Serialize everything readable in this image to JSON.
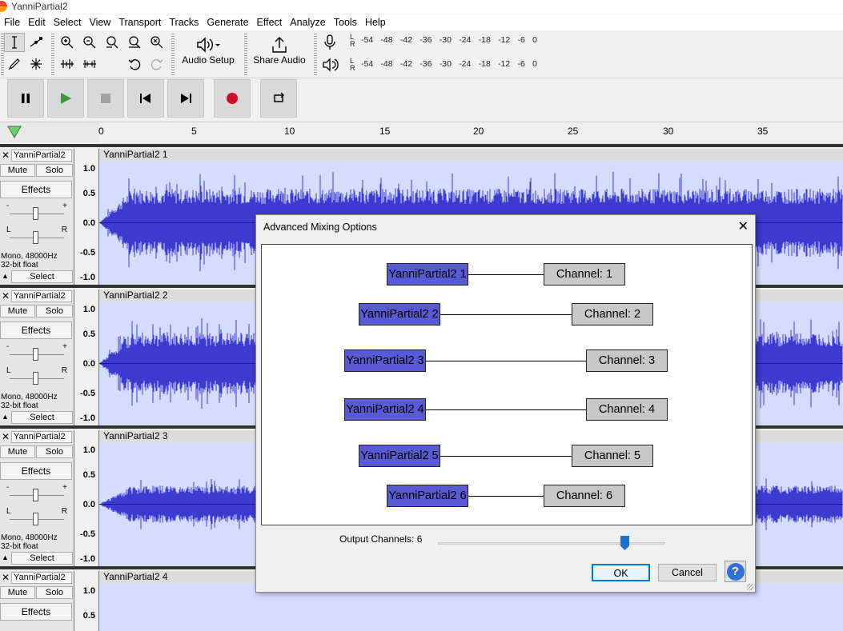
{
  "window": {
    "title": "YanniPartial2"
  },
  "menu": [
    "File",
    "Edit",
    "Select",
    "View",
    "Transport",
    "Tracks",
    "Generate",
    "Effect",
    "Analyze",
    "Tools",
    "Help"
  ],
  "toolbar": {
    "audio_setup": "Audio Setup",
    "share_audio": "Share Audio"
  },
  "meters": {
    "lr_top": "L",
    "lr_bottom": "R",
    "scale": [
      "-54",
      "-48",
      "-42",
      "-36",
      "-30",
      "-24",
      "-18",
      "-12",
      "-6",
      "0"
    ]
  },
  "ruler": {
    "ticks": [
      "0",
      "5",
      "10",
      "15",
      "20",
      "25",
      "30",
      "35"
    ]
  },
  "tracks": [
    {
      "name": "YanniPartial2",
      "clip": "YanniPartial2 1",
      "mute": "Mute",
      "solo": "Solo",
      "effects": "Effects",
      "info1": "Mono, 48000Hz",
      "info2": "32-bit float",
      "select": "Select",
      "scale": [
        "1.0",
        "0.5",
        "0.0",
        "-0.5",
        "-1.0"
      ]
    },
    {
      "name": "YanniPartial2",
      "clip": "YanniPartial2 2",
      "mute": "Mute",
      "solo": "Solo",
      "effects": "Effects",
      "info1": "Mono, 48000Hz",
      "info2": "32-bit float",
      "select": "Select",
      "scale": [
        "1.0",
        "0.5",
        "0.0",
        "-0.5",
        "-1.0"
      ]
    },
    {
      "name": "YanniPartial2",
      "clip": "YanniPartial2 3",
      "mute": "Mute",
      "solo": "Solo",
      "effects": "Effects",
      "info1": "Mono, 48000Hz",
      "info2": "32-bit float",
      "select": "Select",
      "scale": [
        "1.0",
        "0.5",
        "0.0",
        "-0.5",
        "-1.0"
      ]
    },
    {
      "name": "YanniPartial2",
      "clip": "YanniPartial2 4",
      "mute": "Mute",
      "solo": "Solo",
      "effects": "Effects",
      "scale": [
        "1.0",
        "0.5"
      ]
    }
  ],
  "gain_pan": {
    "minus": "-",
    "plus": "+",
    "left": "L",
    "right": "R"
  },
  "dialog": {
    "title": "Advanced Mixing Options",
    "close": "✕",
    "mappings": [
      {
        "track": "YanniPartial2 1",
        "channel": "Channel:  1"
      },
      {
        "track": "YanniPartial2 2",
        "channel": "Channel:  2"
      },
      {
        "track": "YanniPartial2 3",
        "channel": "Channel:  3"
      },
      {
        "track": "YanniPartial2 4",
        "channel": "Channel:  4"
      },
      {
        "track": "YanniPartial2 5",
        "channel": "Channel:  5"
      },
      {
        "track": "YanniPartial2 6",
        "channel": "Channel:  6"
      }
    ],
    "output_label": "Output Channels:  6",
    "output_value": 6,
    "ok": "OK",
    "cancel": "Cancel",
    "help": "?"
  },
  "colors": {
    "waveform": "#3b3bd0",
    "clip_bg": "#d6dcff",
    "track_box": "#5a5ad4",
    "channel_box": "#c8c8c8",
    "accent": "#1a6fd0"
  }
}
